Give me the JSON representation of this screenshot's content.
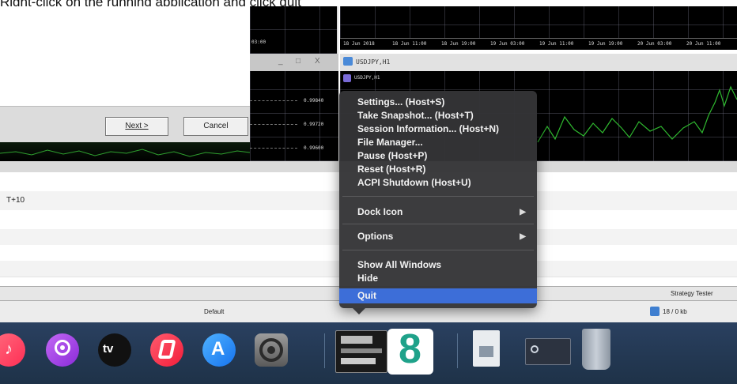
{
  "caption": "Right-click on the running application and click quit",
  "wizard": {
    "next_label": "Next >",
    "cancel_label": "Cancel"
  },
  "charts": {
    "top_right_dates": [
      "18 Jun 2018",
      "18 Jun 11:00",
      "18 Jun 19:00",
      "19 Jun 03:00",
      "19 Jun 11:00",
      "19 Jun 19:00",
      "20 Jun 03:00",
      "20 Jun 11:00"
    ],
    "left_time_label": "03:00",
    "left_prices": [
      "0.99840",
      "0.99720",
      "0.99600"
    ],
    "window_title": "USDJPY,H1",
    "inner_title": "USDJPY,H1",
    "window_controls": [
      "_",
      "□",
      "X"
    ]
  },
  "terminal": {
    "row_text": "T+10",
    "tab_label": "Strategy Tester",
    "status_profile": "Default",
    "status_traffic": "18 / 0 kb"
  },
  "context_menu": {
    "items": [
      {
        "label": "Settings... (Host+S)"
      },
      {
        "label": "Take Snapshot... (Host+T)"
      },
      {
        "label": "Session Information... (Host+N)"
      },
      {
        "label": "File Manager..."
      },
      {
        "label": "Pause (Host+P)"
      },
      {
        "label": "Reset (Host+R)"
      },
      {
        "label": "ACPI Shutdown (Host+U)"
      },
      {
        "label": "Dock Icon"
      },
      {
        "label": "Options"
      },
      {
        "label": "Show All Windows"
      },
      {
        "label": "Hide"
      },
      {
        "label": "Quit"
      }
    ]
  },
  "dock": {
    "tv_label": "tv",
    "items": [
      "music-icon",
      "podcasts-icon",
      "apple-tv-icon",
      "news-icon",
      "app-store-icon",
      "system-preferences-icon",
      "virtualbox-vm-icon",
      "app-8-icon",
      "document-icon",
      "screenshot-icon",
      "trash-icon"
    ]
  },
  "colors": {
    "menu_bg": "#343436",
    "menu_highlight": "#3d6ed8",
    "dock_bg": "#243a55"
  }
}
